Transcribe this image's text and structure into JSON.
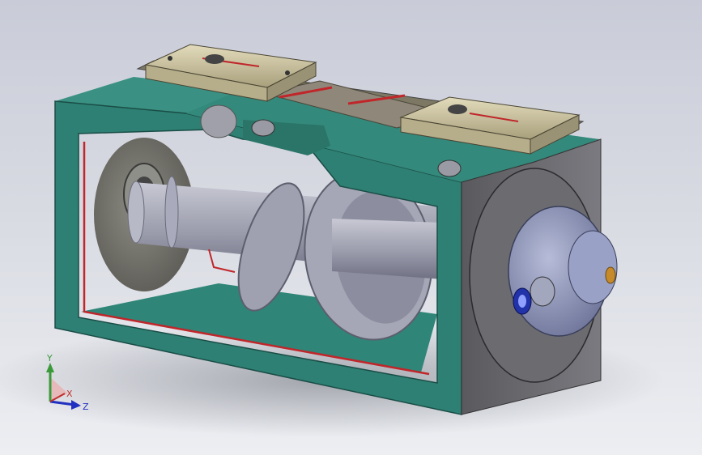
{
  "viewport": {
    "background_top": "#c9ccd8",
    "background_bottom": "#eceef2"
  },
  "model": {
    "housing_color": "#2e8074",
    "housing_dark": "#1f5e55",
    "end_plate_color": "#6e6e72",
    "screw_color": "#a8a9b6",
    "guide_rail_color": "#cfc8a8",
    "seal_color": "#c0262a",
    "motor_color": "#8a92b8",
    "nut_color": "#2233aa"
  },
  "triad": {
    "labels": {
      "y": "Y",
      "x": "X",
      "z": "Z"
    },
    "colors": {
      "y": "#3a9a3a",
      "x": "#c03030",
      "z": "#2030c0"
    }
  }
}
